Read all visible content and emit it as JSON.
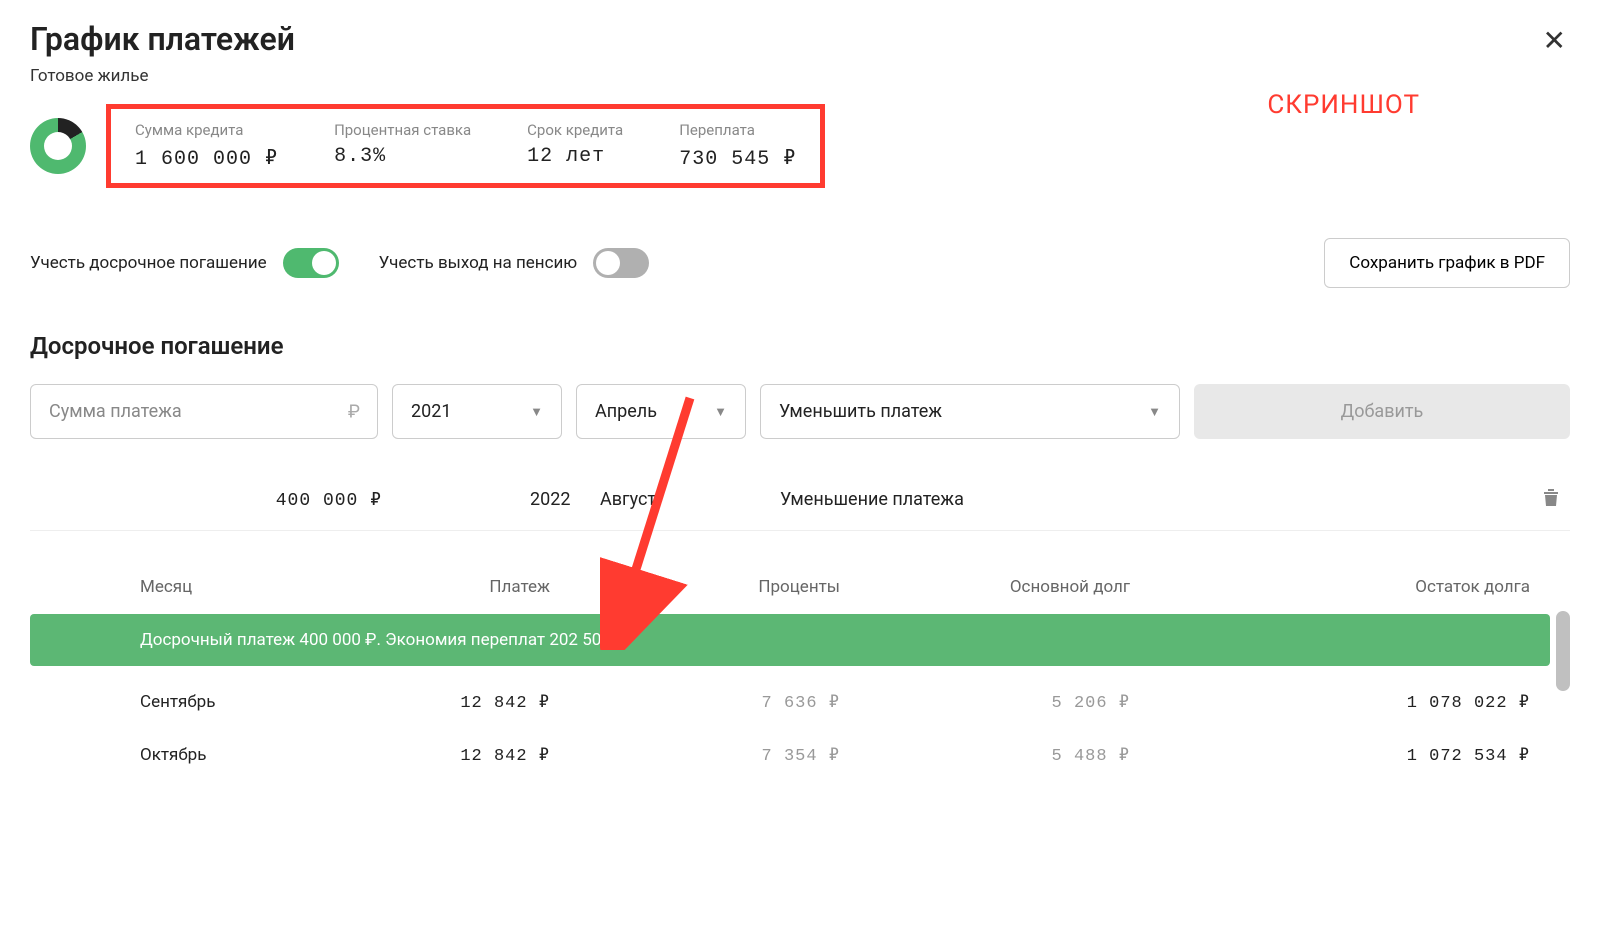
{
  "page": {
    "title": "График платежей",
    "subtitle": "Готовое жилье",
    "annotation": "СКРИНШОТ"
  },
  "summary": {
    "amount_label": "Сумма кредита",
    "amount": "1 600 000 ₽",
    "rate_label": "Процентная ставка",
    "rate": "8.3%",
    "term_label": "Срок кредита",
    "term": "12 лет",
    "overpay_label": "Переплата",
    "overpay": "730 545 ₽"
  },
  "controls": {
    "early_repay_label": "Учесть досрочное погашение",
    "pension_label": "Учесть выход на пенсию",
    "pdf_button": "Сохранить график в PDF"
  },
  "early_section": {
    "heading": "Досрочное погашение",
    "amount_placeholder": "Сумма платежа",
    "year": "2021",
    "month": "Апрель",
    "action": "Уменьшить платеж",
    "add_button": "Добавить"
  },
  "existing": {
    "amount": "400 000 ₽",
    "year": "2022",
    "month": "Август",
    "action": "Уменьшение платежа"
  },
  "table": {
    "headers": {
      "month": "Месяц",
      "payment": "Платеж",
      "interest": "Проценты",
      "principal": "Основной долг",
      "balance": "Остаток долга"
    },
    "banner": "Досрочный платеж 400 000 ₽. Экономия переплат 202 503 ₽.",
    "rows": [
      {
        "month": "Сентябрь",
        "payment": "12 842 ₽",
        "interest": "7 636 ₽",
        "principal": "5 206 ₽",
        "balance": "1 078 022 ₽"
      },
      {
        "month": "Октябрь",
        "payment": "12 842 ₽",
        "interest": "7 354 ₽",
        "principal": "5 488 ₽",
        "balance": "1 072 534 ₽"
      }
    ]
  }
}
